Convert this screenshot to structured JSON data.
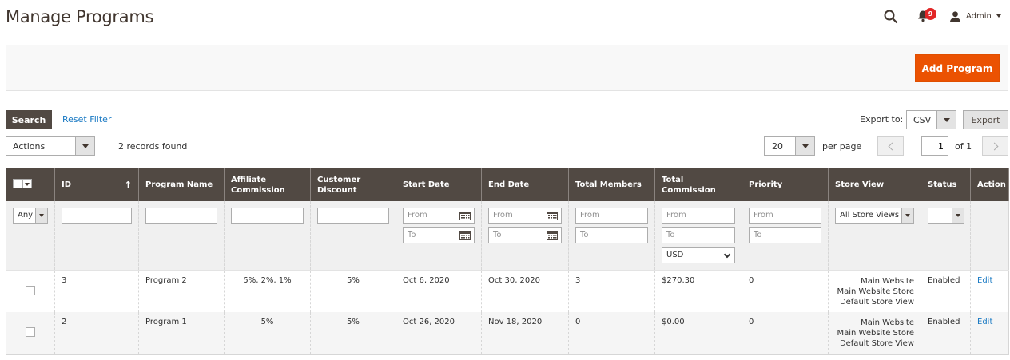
{
  "header": {
    "title": "Manage Programs",
    "notification_count": "9",
    "user_name": "Admin"
  },
  "actions": {
    "add_button": "Add Program"
  },
  "toolbar": {
    "search_button": "Search",
    "reset_filter": "Reset Filter",
    "export_label": "Export to:",
    "export_format": "CSV",
    "export_button": "Export",
    "mass_actions": "Actions",
    "records_found": "2 records found",
    "per_page_value": "20",
    "per_page_label": "per page",
    "current_page": "1",
    "page_of": "of 1"
  },
  "columns": [
    "ID",
    "Program Name",
    "Affiliate Commission",
    "Customer Discount",
    "Start Date",
    "End Date",
    "Total Members",
    "Total Commission",
    "Priority",
    "Store View",
    "Status",
    "Action"
  ],
  "sort": {
    "column": "ID",
    "arrow": "↑"
  },
  "filters": {
    "any": "Any",
    "from": "From",
    "to": "To",
    "currency": "USD",
    "store_view": "All Store Views"
  },
  "rows": [
    {
      "id": "3",
      "name": "Program 2",
      "affiliate_commission": "5%, 2%, 1%",
      "customer_discount": "5%",
      "start_date": "Oct 6, 2020",
      "end_date": "Oct 30, 2020",
      "total_members": "3",
      "total_commission": "$270.30",
      "priority": "0",
      "store_view": [
        "Main Website",
        "Main Website Store",
        "Default Store View"
      ],
      "status": "Enabled",
      "action": "Edit"
    },
    {
      "id": "2",
      "name": "Program 1",
      "affiliate_commission": "5%",
      "customer_discount": "5%",
      "start_date": "Oct 26, 2020",
      "end_date": "Nov 18, 2020",
      "total_members": "0",
      "total_commission": "$0.00",
      "priority": "0",
      "store_view": [
        "Main Website",
        "Main Website Store",
        "Default Store View"
      ],
      "status": "Enabled",
      "action": "Edit"
    }
  ],
  "colors": {
    "accent": "#eb5202",
    "header_bg": "#514943",
    "link": "#1979c3",
    "badge": "#e22626"
  },
  "icons": {
    "search": "search-icon",
    "notifications": "bell-icon",
    "user": "user-icon",
    "calendar": "calendar-icon"
  }
}
